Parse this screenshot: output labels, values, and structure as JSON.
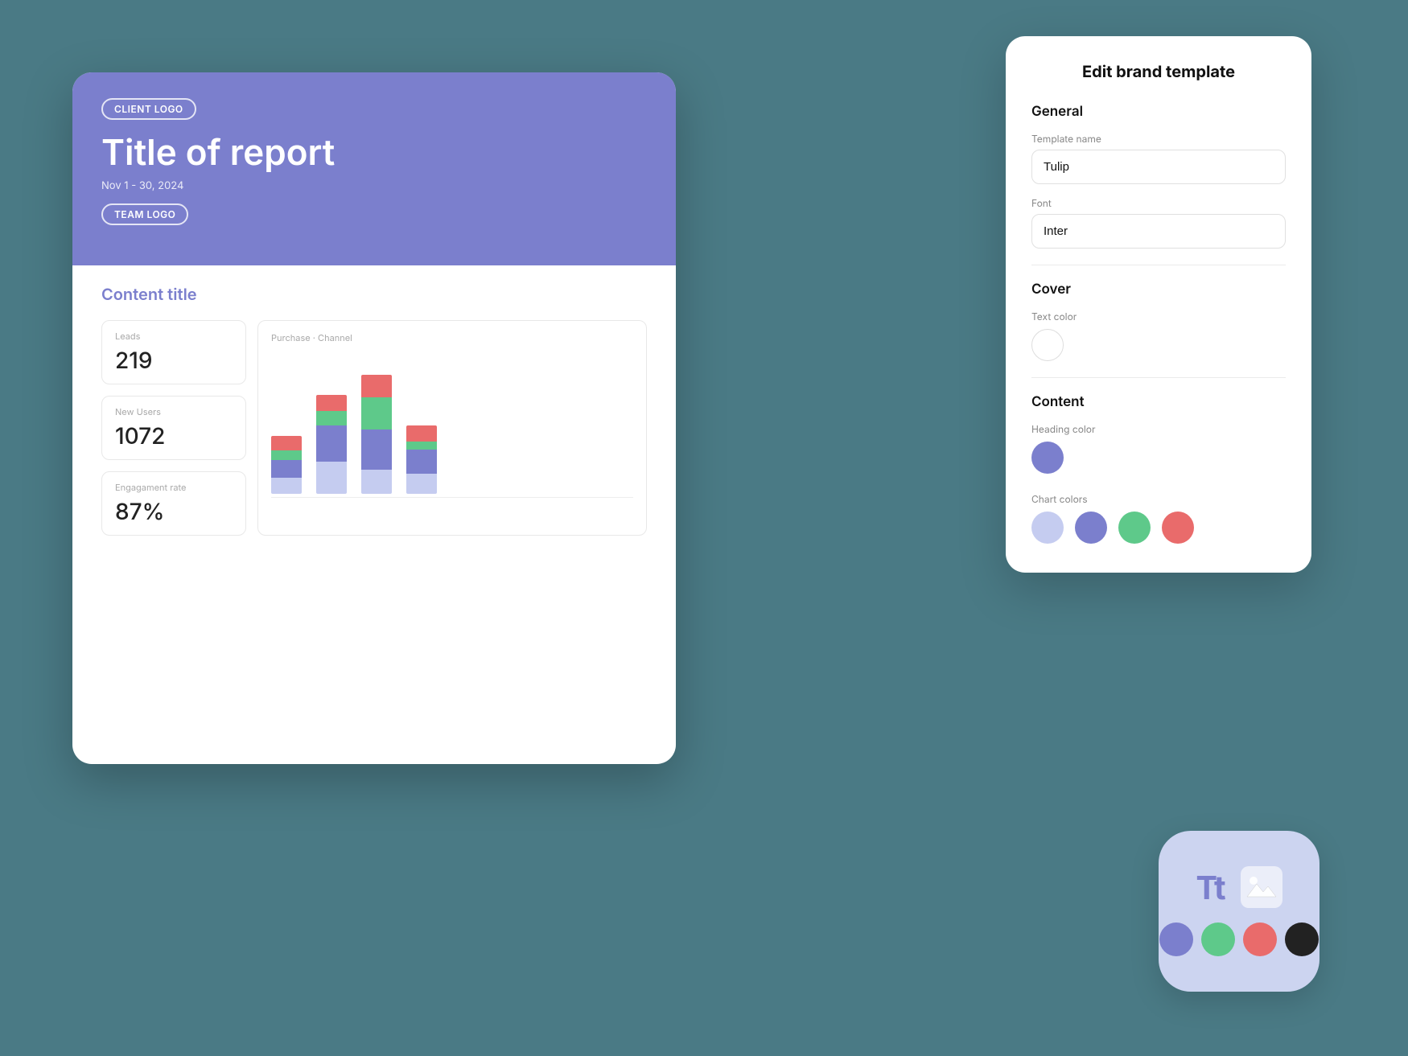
{
  "background_color": "#4a7a85",
  "report_card": {
    "cover": {
      "client_logo_label": "CLIENT LOGO",
      "title": "Title of report",
      "date": "Nov 1 - 30, 2024",
      "team_logo_label": "TEAM LOGO",
      "bg_color": "#7b7fcd"
    },
    "content": {
      "section_title": "Content title",
      "metrics": [
        {
          "label": "Leads",
          "value": "219"
        },
        {
          "label": "New Users",
          "value": "1072"
        },
        {
          "label": "Engagament rate",
          "value": "87%"
        }
      ],
      "chart": {
        "title": "Purchase · Channel",
        "bars": [
          {
            "light": 20,
            "medium": 22,
            "green": 12,
            "red": 18
          },
          {
            "light": 40,
            "medium": 45,
            "green": 18,
            "red": 20
          },
          {
            "light": 30,
            "medium": 50,
            "green": 40,
            "red": 28
          },
          {
            "light": 25,
            "medium": 30,
            "green": 10,
            "red": 20
          }
        ]
      }
    }
  },
  "edit_panel": {
    "title": "Edit brand template",
    "sections": {
      "general": {
        "heading": "General",
        "template_name_label": "Template name",
        "template_name_value": "Tulip",
        "font_label": "Font",
        "font_value": "Inter"
      },
      "cover": {
        "heading": "Cover",
        "text_color_label": "Text color",
        "text_color": "#ffffff"
      },
      "content": {
        "heading": "Content",
        "heading_color_label": "Heading color",
        "heading_color": "#7b7fcd",
        "chart_colors_label": "Chart colors",
        "chart_colors": [
          "#c5ccf0",
          "#7b7fcd",
          "#5ec98a",
          "#e96b6b"
        ]
      }
    }
  },
  "brand_icon": {
    "tt_label": "Tt",
    "colors": [
      "#7b7fcd",
      "#5ec98a",
      "#e96b6b",
      "#222222"
    ]
  }
}
